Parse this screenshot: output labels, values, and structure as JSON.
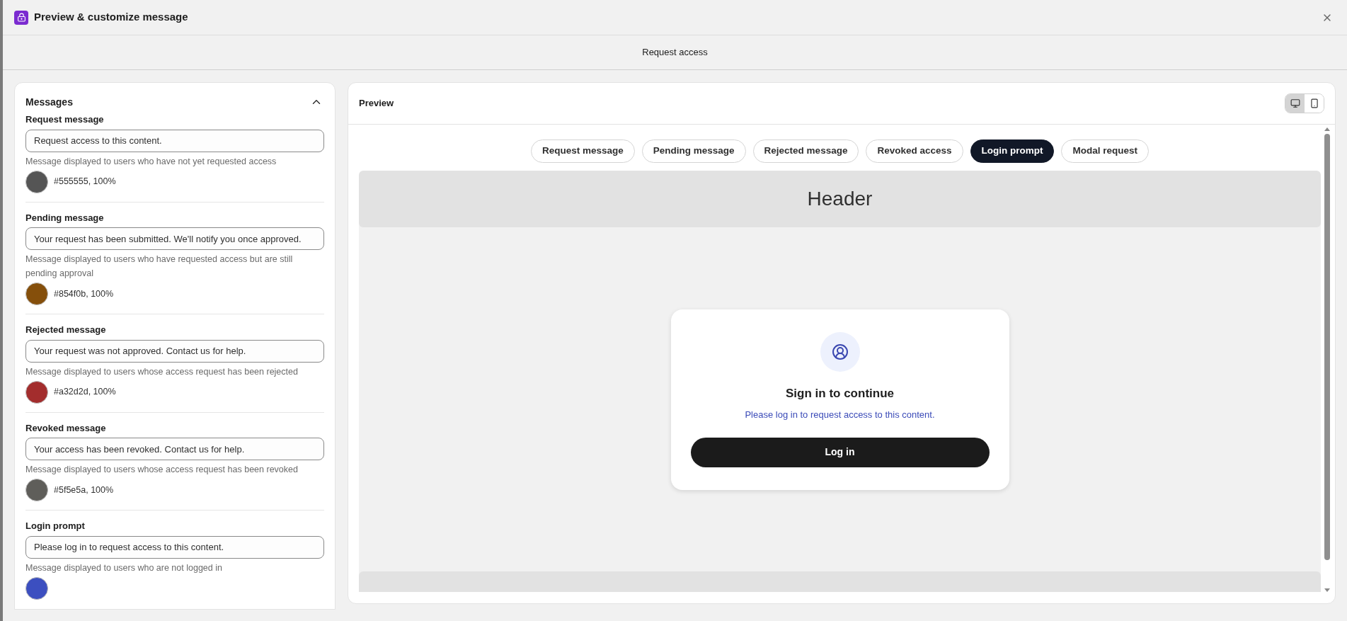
{
  "window": {
    "title": "Preview & customize message"
  },
  "subheader": {
    "title": "Request access"
  },
  "messages_panel": {
    "title": "Messages",
    "expanded": true,
    "items": [
      {
        "label": "Request message",
        "value": "Request access to this content.",
        "help": "Message displayed to users who have not yet requested access",
        "color": "#555555",
        "color_text": "#555555, 100%"
      },
      {
        "label": "Pending message",
        "value": "Your request has been submitted. We'll notify you once approved.",
        "help": "Message displayed to users who have requested access but are still pending approval",
        "color": "#854f0b",
        "color_text": "#854f0b, 100%"
      },
      {
        "label": "Rejected message",
        "value": "Your request was not approved. Contact us for help.",
        "help": "Message displayed to users whose access request has been rejected",
        "color": "#a32d2d",
        "color_text": "#a32d2d, 100%"
      },
      {
        "label": "Revoked message",
        "value": "Your access has been revoked. Contact us for help.",
        "help": "Message displayed to users whose access request has been revoked",
        "color": "#5f5e5a",
        "color_text": "#5f5e5a, 100%"
      },
      {
        "label": "Login prompt",
        "value": "Please log in to request access to this content.",
        "help": "Message displayed to users who are not logged in",
        "color": "#3c4fc0"
      }
    ]
  },
  "preview": {
    "title": "Preview",
    "device_toggle": [
      {
        "kind": "desktop",
        "selected": true
      },
      {
        "kind": "mobile",
        "selected": false
      }
    ],
    "tabs": [
      {
        "label": "Request message",
        "selected": false
      },
      {
        "label": "Pending message",
        "selected": false
      },
      {
        "label": "Rejected message",
        "selected": false
      },
      {
        "label": "Revoked access",
        "selected": false
      },
      {
        "label": "Login prompt",
        "selected": true
      },
      {
        "label": "Modal request",
        "selected": false
      }
    ],
    "page_header": "Header",
    "card": {
      "title": "Sign in to continue",
      "message": "Please log in to request access to this content.",
      "button": "Log in"
    }
  }
}
